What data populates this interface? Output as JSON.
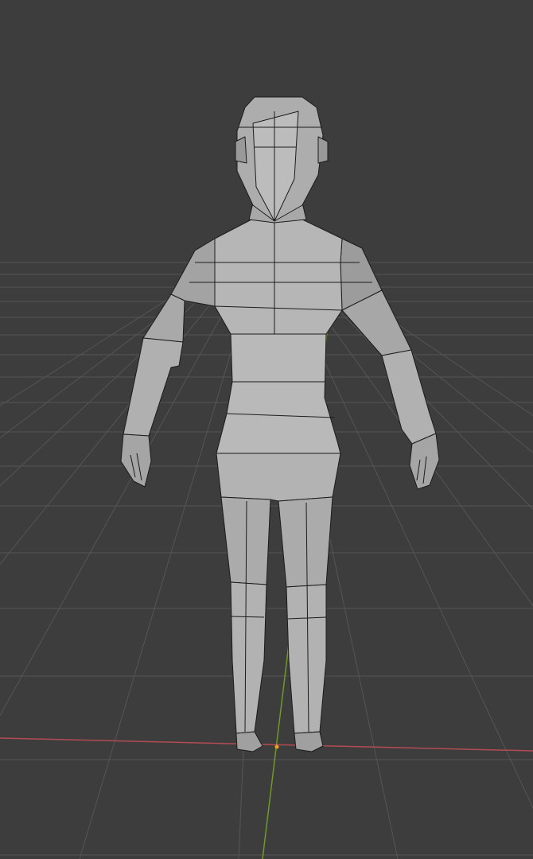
{
  "viewport": {
    "background_color": "#3d3d3d",
    "grid_color": "#555555",
    "x_axis_color": "#b34b55",
    "y_axis_color": "#6d9a2a",
    "origin_color": "#f0a020"
  },
  "model": {
    "fill_color": "#a9a9a9",
    "light_fill_color": "#b8b8b8",
    "dark_fill_color": "#8e8e8e",
    "edge_color": "#1c1c1c"
  }
}
